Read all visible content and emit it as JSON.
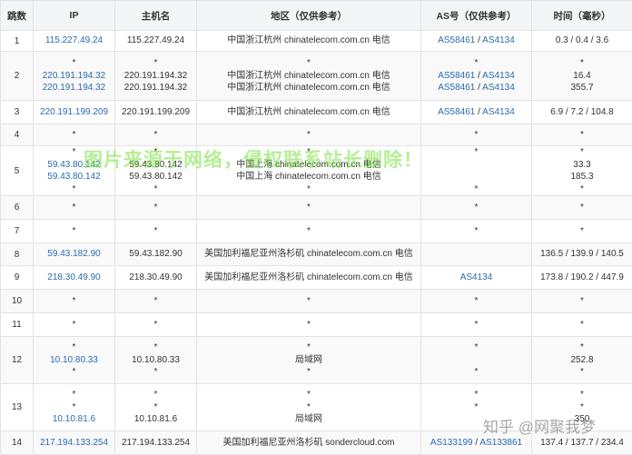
{
  "headers": [
    "跳数",
    "IP",
    "主机名",
    "地区（仅供参考）",
    "AS号（仅供参考）",
    "时间（毫秒）"
  ],
  "rows": [
    {
      "hop": "1",
      "ip": [
        "115.227.49.24"
      ],
      "host": [
        "115.227.49.24"
      ],
      "region": [
        "中国浙江杭州 chinatelecom.com.cn 电信"
      ],
      "as": [
        [
          "AS58461",
          "AS4134"
        ]
      ],
      "time": [
        "0.3 / 0.4 / 3.6"
      ]
    },
    {
      "hop": "2",
      "ip": [
        "*",
        "220.191.194.32",
        "220.191.194.32"
      ],
      "host": [
        "*",
        "220.191.194.32",
        "220.191.194.32"
      ],
      "region": [
        "*",
        "中国浙江杭州 chinatelecom.com.cn 电信",
        "中国浙江杭州 chinatelecom.com.cn 电信"
      ],
      "as": [
        [
          "*"
        ],
        [
          "AS58461",
          "AS4134"
        ],
        [
          "AS58461",
          "AS4134"
        ]
      ],
      "time": [
        "*",
        "16.4",
        "355.7"
      ]
    },
    {
      "hop": "3",
      "ip": [
        "220.191.199.209"
      ],
      "host": [
        "220.191.199.209"
      ],
      "region": [
        "中国浙江杭州 chinatelecom.com.cn 电信"
      ],
      "as": [
        [
          "AS58461",
          "AS4134"
        ]
      ],
      "time": [
        "6.9 / 7.2 / 104.8"
      ]
    },
    {
      "hop": "4",
      "ip": [
        "*"
      ],
      "host": [
        "*"
      ],
      "region": [
        "*"
      ],
      "as": [
        [
          "*"
        ]
      ],
      "time": [
        "*"
      ]
    },
    {
      "hop": "5",
      "ip": [
        "*",
        "59.43.80.142",
        "59.43.80.142",
        "*"
      ],
      "host": [
        "*",
        "59.43.80.142",
        "59.43.80.142",
        "*"
      ],
      "region": [
        "*",
        "中国上海 chinatelecom.com.cn 电信",
        "中国上海 chinatelecom.com.cn 电信",
        "*"
      ],
      "as": [
        [
          "*"
        ],
        [
          ""
        ],
        [
          ""
        ],
        [
          "*"
        ]
      ],
      "time": [
        "*",
        "33.3",
        "185.3",
        "*"
      ]
    },
    {
      "hop": "6",
      "ip": [
        "*"
      ],
      "host": [
        "*"
      ],
      "region": [
        "*"
      ],
      "as": [
        [
          "*"
        ]
      ],
      "time": [
        "*"
      ]
    },
    {
      "hop": "7",
      "ip": [
        "*"
      ],
      "host": [
        "*"
      ],
      "region": [
        "*"
      ],
      "as": [
        [
          "*"
        ]
      ],
      "time": [
        "*"
      ]
    },
    {
      "hop": "8",
      "ip": [
        "59.43.182.90"
      ],
      "host": [
        "59.43.182.90"
      ],
      "region": [
        "美国加利福尼亚州洛杉矶 chinatelecom.com.cn 电信"
      ],
      "as": [
        [
          ""
        ]
      ],
      "time": [
        "136.5 / 139.9 / 140.5"
      ]
    },
    {
      "hop": "9",
      "ip": [
        "218.30.49.90"
      ],
      "host": [
        "218.30.49.90"
      ],
      "region": [
        "美国加利福尼亚州洛杉矶 chinatelecom.com.cn 电信"
      ],
      "as": [
        [
          "AS4134"
        ]
      ],
      "time": [
        "173.8 / 190.2 / 447.9"
      ]
    },
    {
      "hop": "10",
      "ip": [
        "*"
      ],
      "host": [
        "*"
      ],
      "region": [
        "*"
      ],
      "as": [
        [
          "*"
        ]
      ],
      "time": [
        "*"
      ]
    },
    {
      "hop": "11",
      "ip": [
        "*"
      ],
      "host": [
        "*"
      ],
      "region": [
        "*"
      ],
      "as": [
        [
          "*"
        ]
      ],
      "time": [
        "*"
      ]
    },
    {
      "hop": "12",
      "ip": [
        "*",
        "10.10.80.33",
        "*"
      ],
      "host": [
        "*",
        "10.10.80.33",
        "*"
      ],
      "region": [
        "*",
        "局域网",
        "*"
      ],
      "as": [
        [
          "*"
        ],
        [
          ""
        ],
        [
          "*"
        ]
      ],
      "time": [
        "*",
        "252.8",
        "*"
      ]
    },
    {
      "hop": "13",
      "ip": [
        "*",
        "*",
        "10.10.81.6"
      ],
      "host": [
        "*",
        "*",
        "10.10.81.6"
      ],
      "region": [
        "*",
        "*",
        "局域网"
      ],
      "as": [
        [
          "*"
        ],
        [
          "*"
        ],
        [
          ""
        ]
      ],
      "time": [
        "*",
        "*",
        "350"
      ]
    },
    {
      "hop": "14",
      "ip": [
        "217.194.133.254"
      ],
      "host": [
        "217.194.133.254"
      ],
      "region": [
        "美国加利福尼亚州洛杉矶 sondercloud.com"
      ],
      "as": [
        [
          "AS133199",
          "AS133861"
        ]
      ],
      "time": [
        "137.4 / 137.7 / 234.4"
      ]
    }
  ],
  "watermark": "图片来源于网络，侵权联系站长删除！",
  "zhihu_mark": "知乎 @网聚我梦",
  "colors": {
    "link": "#2a6bb0",
    "header_bg": "#f3f5f7",
    "border": "#e3e3e3",
    "watermark": "#78e13c"
  }
}
